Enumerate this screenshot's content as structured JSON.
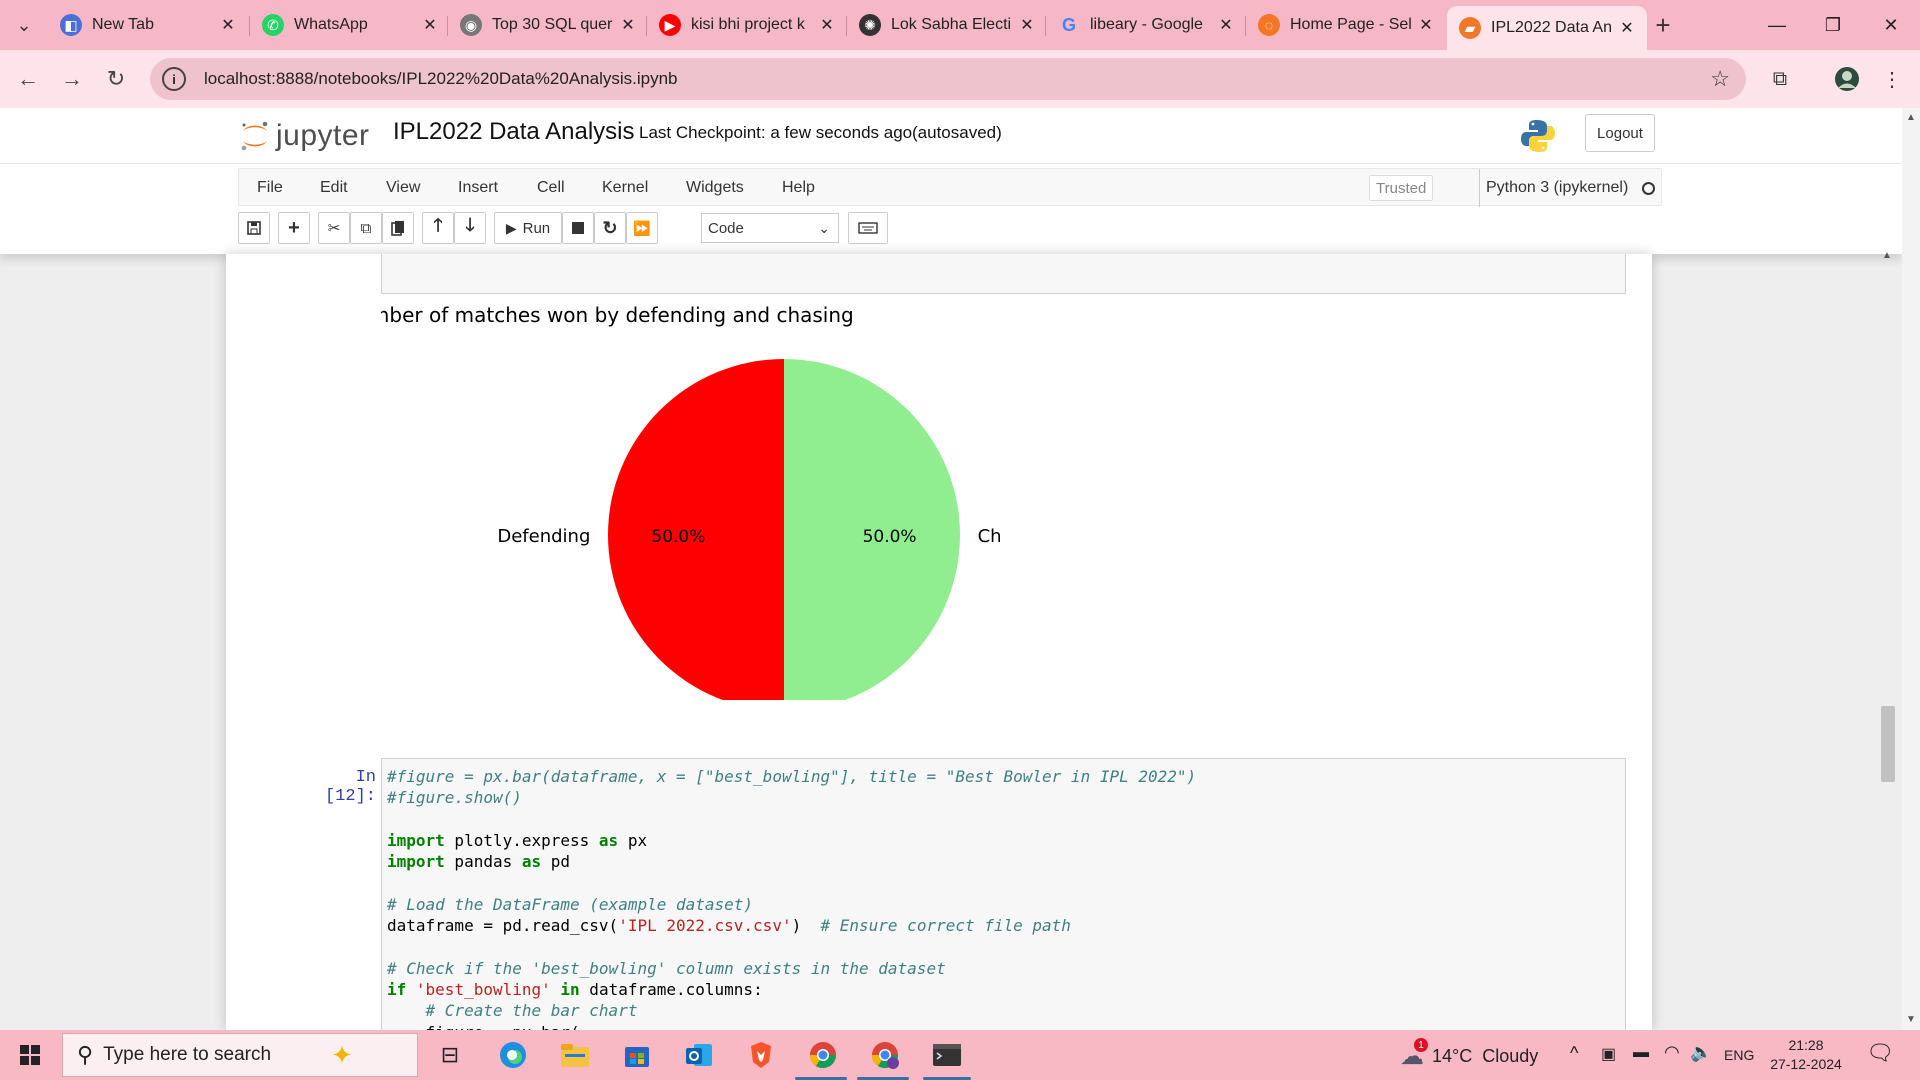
{
  "browser": {
    "tabs": [
      {
        "title": "New Tab",
        "icon": "newtab-icon"
      },
      {
        "title": "WhatsApp",
        "icon": "whatsapp-icon"
      },
      {
        "title": "Top 30 SQL quer",
        "icon": "globe-icon"
      },
      {
        "title": "kisi bhi project k",
        "icon": "youtube-icon"
      },
      {
        "title": "Lok Sabha Electi",
        "icon": "openai-icon"
      },
      {
        "title": "libeary - Google",
        "icon": "google-icon"
      },
      {
        "title": "Home Page - Sel",
        "icon": "loading-icon"
      },
      {
        "title": "IPL2022 Data An",
        "icon": "jupyter-tab-icon"
      }
    ],
    "url": "localhost:8888/notebooks/IPL2022%20Data%20Analysis.ipynb"
  },
  "jupyter": {
    "logo_text": "jupyter",
    "notebook_name": "IPL2022 Data Analysis",
    "checkpoint": "Last Checkpoint: a few seconds ago",
    "autosave": "(autosaved)",
    "logout": "Logout",
    "menus": [
      "File",
      "Edit",
      "View",
      "Insert",
      "Cell",
      "Kernel",
      "Widgets",
      "Help"
    ],
    "trusted": "Trusted",
    "kernel": "Python 3 (ipykernel)",
    "run_label": "Run",
    "cell_type": "Code"
  },
  "chart_data": {
    "type": "pie",
    "title": "Number of matches won by defending and chasing",
    "labels": [
      "Defending",
      "Chasing"
    ],
    "values": [
      50.0,
      50.0
    ],
    "value_labels": [
      "50.0%",
      "50.0%"
    ],
    "colors": [
      "#ff0000",
      "#90ee90"
    ]
  },
  "code_cell": {
    "prompt": "In [12]:",
    "lines": [
      {
        "parts": [
          {
            "c": "cm",
            "t": "#figure = px.bar(dataframe, x = [\"best_bowling\"], title = \"Best Bowler in IPL 2022\")"
          }
        ]
      },
      {
        "parts": [
          {
            "c": "cm",
            "t": "#figure.show()"
          }
        ]
      },
      {
        "parts": []
      },
      {
        "parts": [
          {
            "c": "kw",
            "t": "import"
          },
          {
            "c": "",
            "t": " plotly.express "
          },
          {
            "c": "kw",
            "t": "as"
          },
          {
            "c": "",
            "t": " px"
          }
        ]
      },
      {
        "parts": [
          {
            "c": "kw",
            "t": "import"
          },
          {
            "c": "",
            "t": " pandas "
          },
          {
            "c": "kw",
            "t": "as"
          },
          {
            "c": "",
            "t": " pd"
          }
        ]
      },
      {
        "parts": []
      },
      {
        "parts": [
          {
            "c": "cm",
            "t": "# Load the DataFrame (example dataset)"
          }
        ]
      },
      {
        "parts": [
          {
            "c": "",
            "t": "dataframe = pd.read_csv("
          },
          {
            "c": "st",
            "t": "'IPL 2022.csv.csv'"
          },
          {
            "c": "",
            "t": ")  "
          },
          {
            "c": "cm",
            "t": "# Ensure correct file path"
          }
        ]
      },
      {
        "parts": []
      },
      {
        "parts": [
          {
            "c": "cm",
            "t": "# Check if the 'best_bowling' column exists in the dataset"
          }
        ]
      },
      {
        "parts": [
          {
            "c": "kw",
            "t": "if"
          },
          {
            "c": "",
            "t": " "
          },
          {
            "c": "st",
            "t": "'best_bowling'"
          },
          {
            "c": "",
            "t": " "
          },
          {
            "c": "kw",
            "t": "in"
          },
          {
            "c": "",
            "t": " dataframe.columns:"
          }
        ]
      },
      {
        "parts": [
          {
            "c": "",
            "t": "    "
          },
          {
            "c": "cm",
            "t": "# Create the bar chart"
          }
        ]
      },
      {
        "parts": [
          {
            "c": "",
            "t": "    figure = px.bar("
          }
        ]
      }
    ]
  },
  "taskbar": {
    "search_placeholder": "Type here to search",
    "weather": "14°C  Cloudy",
    "weather_badge": "1",
    "language": "ENG",
    "time": "21:28",
    "date": "27-12-2024"
  }
}
